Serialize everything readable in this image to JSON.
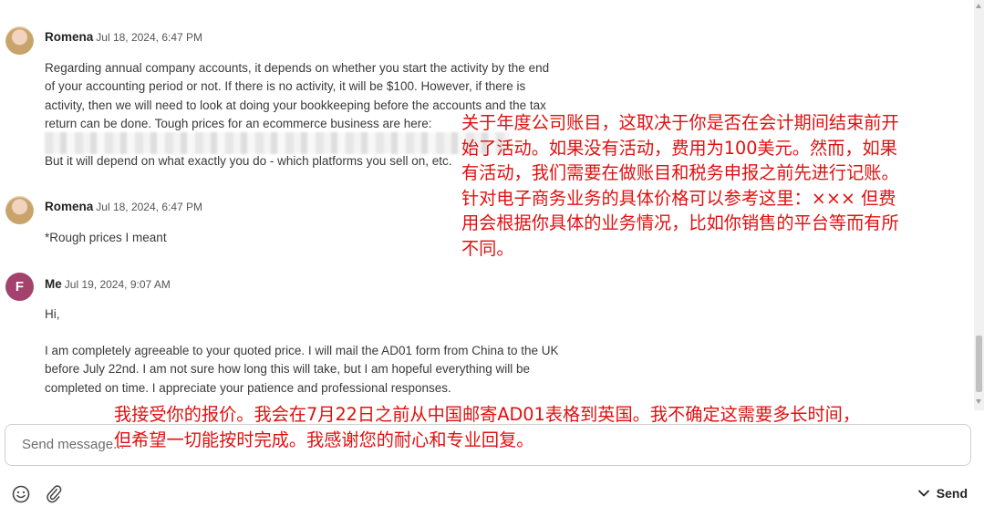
{
  "messages": [
    {
      "sender": "Romena",
      "time": "Jul 18, 2024, 6:47 PM",
      "lines": [
        "Regarding annual company accounts, it depends on whether you start the activity by the end",
        "of your accounting period or not. If there is no activity, it will be $100. However, if there is",
        "activity, then we will need to look at doing your bookkeeping before the accounts and the tax",
        "return can be done. Tough prices for an ecommerce business are here:"
      ],
      "line2": "But it will depend on what exactly you do - which platforms you sell on, etc."
    },
    {
      "sender": "Romena",
      "time": "Jul 18, 2024, 6:47 PM",
      "text": "*Rough prices I meant"
    },
    {
      "sender": "Me",
      "avatar_letter": "F",
      "time": "Jul 19, 2024, 9:07 AM",
      "greeting": "Hi,",
      "lines": [
        "I am completely agreeable to your quoted price. I will mail the AD01 form from China to the UK",
        "before July 22nd. I am not sure how long this will take, but I am hopeful everything will be",
        "completed on time. I appreciate your patience and professional responses."
      ]
    }
  ],
  "annotations": {
    "first": [
      "关于年度公司账目，这取决于你是否在会计期间结束前开",
      "始了活动。如果没有活动，费用为100美元。然而，如果",
      "有活动，我们需要在做账目和税务申报之前先进行记账。",
      "针对电子商务业务的具体价格可以参考这里：×××  但费",
      "用会根据你具体的业务情况，比如你销售的平台等而有所",
      "不同。"
    ],
    "second": [
      "我接受你的报价。我会在7月22日之前从中国邮寄AD01表格到英国。我不确定这需要多长时间，",
      "但希望一切能按时完成。我感谢您的耐心和专业回复。"
    ]
  },
  "composer": {
    "placeholder": "Send message...",
    "send_label": "Send"
  },
  "colors": {
    "annotation": "#e01010",
    "avatar_me": "#a3426c"
  }
}
